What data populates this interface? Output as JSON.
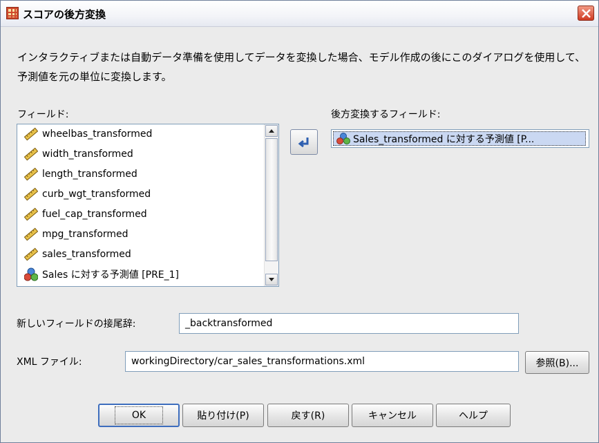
{
  "window": {
    "title": "スコアの後方変換"
  },
  "description": "インタラクティブまたは自動データ準備を使用してデータを変換した場合、モデル作成の後にこのダイアログを使用して、予測値を元の単位に変換します。",
  "fields": {
    "label": "フィールド:",
    "items": [
      {
        "label": "wheelbas_transformed",
        "icon": "ruler-icon"
      },
      {
        "label": "width_transformed",
        "icon": "ruler-icon"
      },
      {
        "label": "length_transformed",
        "icon": "ruler-icon"
      },
      {
        "label": "curb_wgt_transformed",
        "icon": "ruler-icon"
      },
      {
        "label": "fuel_cap_transformed",
        "icon": "ruler-icon"
      },
      {
        "label": "mpg_transformed",
        "icon": "ruler-icon"
      },
      {
        "label": "sales_transformed",
        "icon": "ruler-icon"
      },
      {
        "label": "Sales に対する予測値 [PRE_1]",
        "icon": "nominal-icon"
      }
    ]
  },
  "target": {
    "label": "後方変換するフィールド:",
    "item": "Sales_transformed に対する予測値 [P..."
  },
  "suffix": {
    "label": "新しいフィールドの接尾辞:",
    "value": "_backtransformed"
  },
  "xml": {
    "label": "XML ファイル:",
    "value": "workingDirectory/car_sales_transformations.xml",
    "browse": "参照(B)..."
  },
  "buttons": {
    "ok": "OK",
    "paste": "貼り付け(P)",
    "reset": "戻す(R)",
    "cancel": "キャンセル",
    "help": "ヘルプ"
  },
  "colors": {
    "selection": "#cad8f2",
    "accent": "#3d6dbd",
    "close": "#cf3a21"
  }
}
